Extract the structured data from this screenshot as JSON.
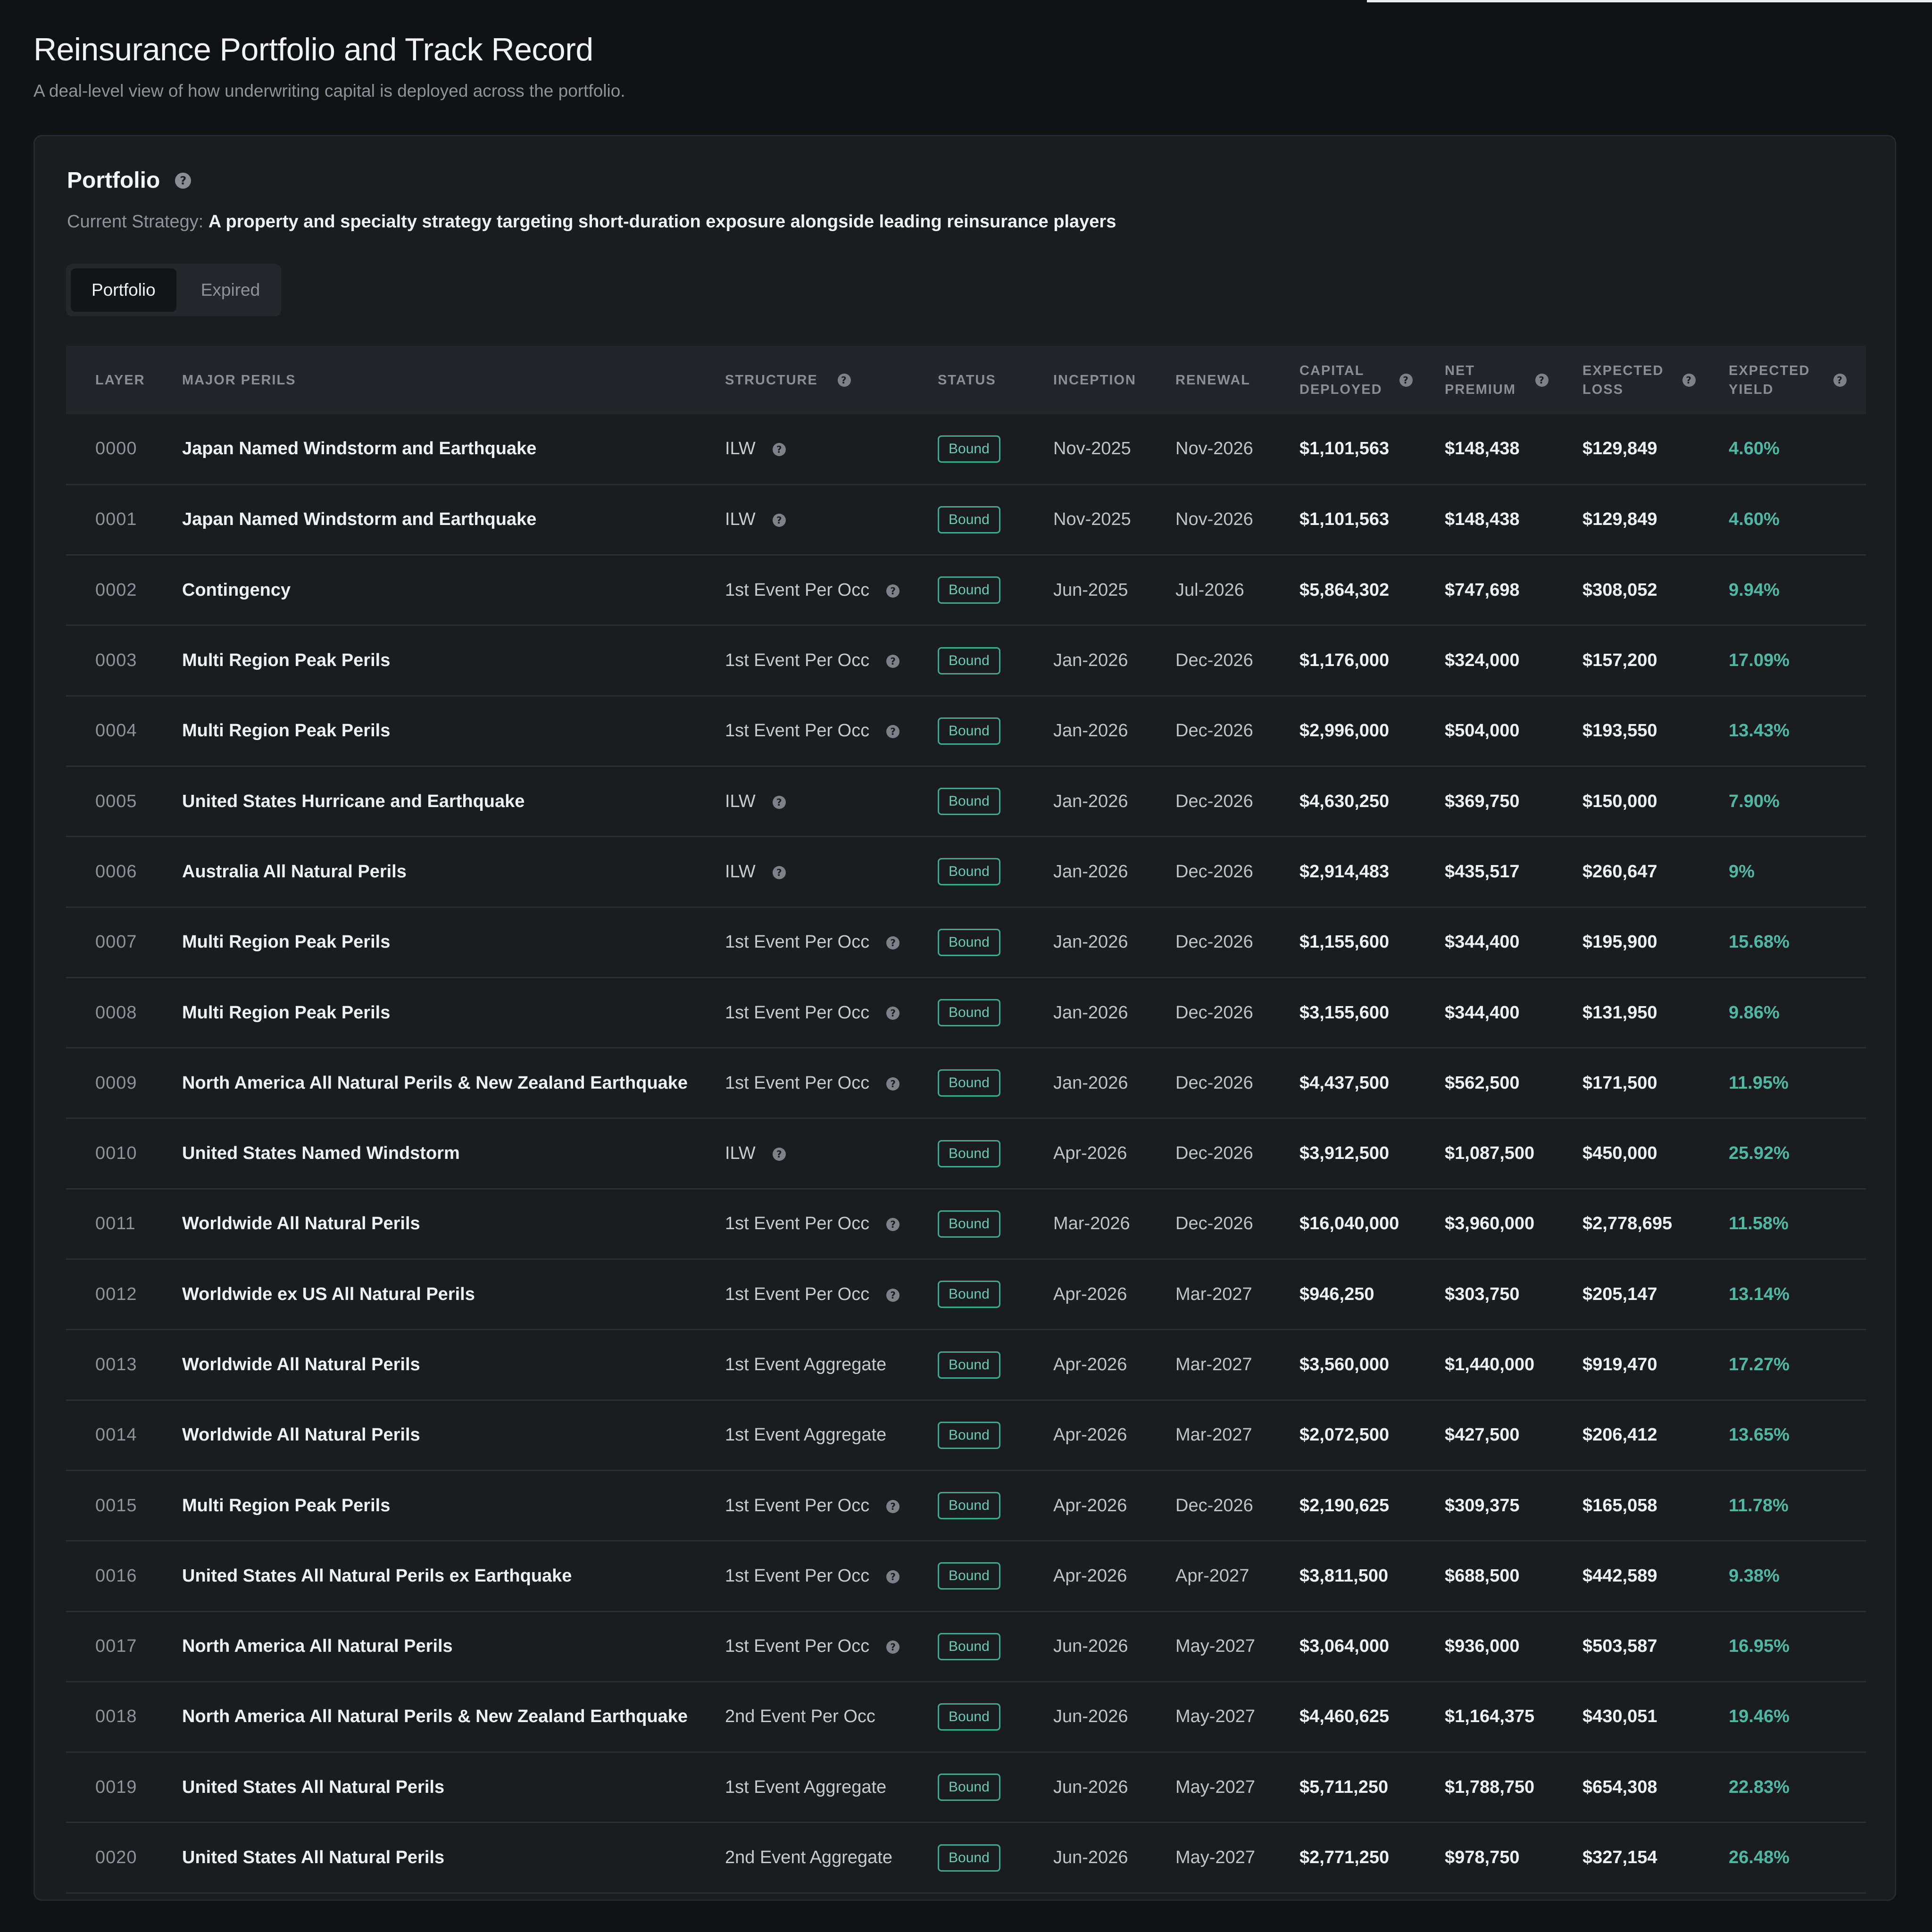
{
  "header": {
    "title": "Reinsurance Portfolio and Track Record",
    "subtitle": "A deal-level view of how underwriting capital is deployed across the portfolio."
  },
  "card": {
    "title": "Portfolio",
    "strategy_label": "Current Strategy:",
    "strategy_text": "A property and specialty strategy targeting short-duration exposure alongside leading reinsurance players"
  },
  "tabs": [
    {
      "label": "Portfolio",
      "active": true
    },
    {
      "label": "Expired",
      "active": false
    }
  ],
  "columns": {
    "layer": "Layer",
    "perils": "Major Perils",
    "structure": "Structure",
    "status": "Status",
    "inception": "Inception",
    "renewal": "Renewal",
    "capital": "Capital Deployed",
    "premium": "Net Premium",
    "loss": "Expected Loss",
    "yield": "Expected Yield"
  },
  "rows": [
    {
      "layer": "0000",
      "perils": "Japan Named Windstorm and Earthquake",
      "structure": "ILW",
      "help": true,
      "status": "Bound",
      "inception": "Nov-2025",
      "renewal": "Nov-2026",
      "capital": "$1,101,563",
      "premium": "$148,438",
      "loss": "$129,849",
      "yield": "4.60%"
    },
    {
      "layer": "0001",
      "perils": "Japan Named Windstorm and Earthquake",
      "structure": "ILW",
      "help": true,
      "status": "Bound",
      "inception": "Nov-2025",
      "renewal": "Nov-2026",
      "capital": "$1,101,563",
      "premium": "$148,438",
      "loss": "$129,849",
      "yield": "4.60%"
    },
    {
      "layer": "0002",
      "perils": "Contingency",
      "structure": "1st Event Per Occ",
      "help": true,
      "status": "Bound",
      "inception": "Jun-2025",
      "renewal": "Jul-2026",
      "capital": "$5,864,302",
      "premium": "$747,698",
      "loss": "$308,052",
      "yield": "9.94%"
    },
    {
      "layer": "0003",
      "perils": "Multi Region Peak Perils",
      "structure": "1st Event Per Occ",
      "help": true,
      "status": "Bound",
      "inception": "Jan-2026",
      "renewal": "Dec-2026",
      "capital": "$1,176,000",
      "premium": "$324,000",
      "loss": "$157,200",
      "yield": "17.09%"
    },
    {
      "layer": "0004",
      "perils": "Multi Region Peak Perils",
      "structure": "1st Event Per Occ",
      "help": true,
      "status": "Bound",
      "inception": "Jan-2026",
      "renewal": "Dec-2026",
      "capital": "$2,996,000",
      "premium": "$504,000",
      "loss": "$193,550",
      "yield": "13.43%"
    },
    {
      "layer": "0005",
      "perils": "United States Hurricane and Earthquake",
      "structure": "ILW",
      "help": true,
      "status": "Bound",
      "inception": "Jan-2026",
      "renewal": "Dec-2026",
      "capital": "$4,630,250",
      "premium": "$369,750",
      "loss": "$150,000",
      "yield": "7.90%"
    },
    {
      "layer": "0006",
      "perils": "Australia All Natural Perils",
      "structure": "ILW",
      "help": true,
      "status": "Bound",
      "inception": "Jan-2026",
      "renewal": "Dec-2026",
      "capital": "$2,914,483",
      "premium": "$435,517",
      "loss": "$260,647",
      "yield": "9%"
    },
    {
      "layer": "0007",
      "perils": "Multi Region Peak Perils",
      "structure": "1st Event Per Occ",
      "help": true,
      "status": "Bound",
      "inception": "Jan-2026",
      "renewal": "Dec-2026",
      "capital": "$1,155,600",
      "premium": "$344,400",
      "loss": "$195,900",
      "yield": "15.68%"
    },
    {
      "layer": "0008",
      "perils": "Multi Region Peak Perils",
      "structure": "1st Event Per Occ",
      "help": true,
      "status": "Bound",
      "inception": "Jan-2026",
      "renewal": "Dec-2026",
      "capital": "$3,155,600",
      "premium": "$344,400",
      "loss": "$131,950",
      "yield": "9.86%"
    },
    {
      "layer": "0009",
      "perils": "North America All Natural Perils & New Zealand Earthquake",
      "structure": "1st Event Per Occ",
      "help": true,
      "status": "Bound",
      "inception": "Jan-2026",
      "renewal": "Dec-2026",
      "capital": "$4,437,500",
      "premium": "$562,500",
      "loss": "$171,500",
      "yield": "11.95%"
    },
    {
      "layer": "0010",
      "perils": "United States Named Windstorm",
      "structure": "ILW",
      "help": true,
      "status": "Bound",
      "inception": "Apr-2026",
      "renewal": "Dec-2026",
      "capital": "$3,912,500",
      "premium": "$1,087,500",
      "loss": "$450,000",
      "yield": "25.92%"
    },
    {
      "layer": "0011",
      "perils": "Worldwide All Natural Perils",
      "structure": "1st Event Per Occ",
      "help": true,
      "status": "Bound",
      "inception": "Mar-2026",
      "renewal": "Dec-2026",
      "capital": "$16,040,000",
      "premium": "$3,960,000",
      "loss": "$2,778,695",
      "yield": "11.58%"
    },
    {
      "layer": "0012",
      "perils": "Worldwide ex US All Natural Perils",
      "structure": "1st Event Per Occ",
      "help": true,
      "status": "Bound",
      "inception": "Apr-2026",
      "renewal": "Mar-2027",
      "capital": "$946,250",
      "premium": "$303,750",
      "loss": "$205,147",
      "yield": "13.14%"
    },
    {
      "layer": "0013",
      "perils": "Worldwide All Natural Perils",
      "structure": "1st Event Aggregate",
      "help": false,
      "status": "Bound",
      "inception": "Apr-2026",
      "renewal": "Mar-2027",
      "capital": "$3,560,000",
      "premium": "$1,440,000",
      "loss": "$919,470",
      "yield": "17.27%"
    },
    {
      "layer": "0014",
      "perils": "Worldwide All Natural Perils",
      "structure": "1st Event Aggregate",
      "help": false,
      "status": "Bound",
      "inception": "Apr-2026",
      "renewal": "Mar-2027",
      "capital": "$2,072,500",
      "premium": "$427,500",
      "loss": "$206,412",
      "yield": "13.65%"
    },
    {
      "layer": "0015",
      "perils": "Multi Region Peak Perils",
      "structure": "1st Event Per Occ",
      "help": true,
      "status": "Bound",
      "inception": "Apr-2026",
      "renewal": "Dec-2026",
      "capital": "$2,190,625",
      "premium": "$309,375",
      "loss": "$165,058",
      "yield": "11.78%"
    },
    {
      "layer": "0016",
      "perils": "United States All Natural Perils ex Earthquake",
      "structure": "1st Event Per Occ",
      "help": true,
      "status": "Bound",
      "inception": "Apr-2026",
      "renewal": "Apr-2027",
      "capital": "$3,811,500",
      "premium": "$688,500",
      "loss": "$442,589",
      "yield": "9.38%"
    },
    {
      "layer": "0017",
      "perils": "North America All Natural Perils",
      "structure": "1st Event Per Occ",
      "help": true,
      "status": "Bound",
      "inception": "Jun-2026",
      "renewal": "May-2027",
      "capital": "$3,064,000",
      "premium": "$936,000",
      "loss": "$503,587",
      "yield": "16.95%"
    },
    {
      "layer": "0018",
      "perils": "North America All Natural Perils & New Zealand Earthquake",
      "structure": "2nd Event Per Occ",
      "help": false,
      "status": "Bound",
      "inception": "Jun-2026",
      "renewal": "May-2027",
      "capital": "$4,460,625",
      "premium": "$1,164,375",
      "loss": "$430,051",
      "yield": "19.46%"
    },
    {
      "layer": "0019",
      "perils": "United States All Natural Perils",
      "structure": "1st Event Aggregate",
      "help": false,
      "status": "Bound",
      "inception": "Jun-2026",
      "renewal": "May-2027",
      "capital": "$5,711,250",
      "premium": "$1,788,750",
      "loss": "$654,308",
      "yield": "22.83%"
    },
    {
      "layer": "0020",
      "perils": "United States All Natural Perils",
      "structure": "2nd Event Aggregate",
      "help": false,
      "status": "Bound",
      "inception": "Jun-2026",
      "renewal": "May-2027",
      "capital": "$2,771,250",
      "premium": "$978,750",
      "loss": "$327,154",
      "yield": "26.48%"
    }
  ],
  "icons": {
    "help": "question-circle-icon"
  },
  "colors": {
    "accent": "#4fb8a4",
    "badge_border": "#3fa893",
    "background": "#111214",
    "card": "#1a1c20"
  }
}
